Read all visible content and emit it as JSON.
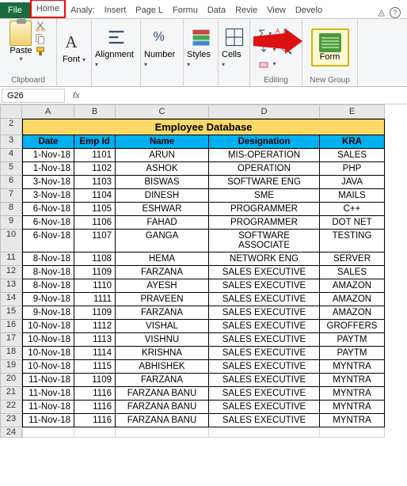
{
  "tabs": {
    "file": "File",
    "home": "Home",
    "analysis": "Analy:",
    "insert": "Insert",
    "pagelayout": "Page L",
    "formulas": "Formu",
    "data": "Data",
    "review": "Revie",
    "view": "View",
    "developer": "Develo"
  },
  "ribbon": {
    "clipboard": {
      "label": "Clipboard",
      "paste": "Paste"
    },
    "font": {
      "label": "Font"
    },
    "alignment": {
      "label": "Alignment"
    },
    "number": {
      "label": "Number"
    },
    "styles": {
      "label": "Styles"
    },
    "cells": {
      "label": "Cells"
    },
    "editing": {
      "label": "Editing"
    },
    "newgroup": {
      "label": "New Group",
      "form": "Form"
    }
  },
  "namebox": "G26",
  "fx": "fx",
  "columns": [
    "A",
    "B",
    "C",
    "D",
    "E"
  ],
  "title": "Employee Database",
  "headers": {
    "date": "Date",
    "empid": "Emp Id",
    "name": "Name",
    "designation": "Designation",
    "kra": "KRA"
  },
  "rows": [
    {
      "n": 4,
      "date": "1-Nov-18",
      "id": "1101",
      "name": "ARUN",
      "desig": "MIS-OPERATION",
      "kra": "SALES"
    },
    {
      "n": 5,
      "date": "1-Nov-18",
      "id": "1102",
      "name": "ASHOK",
      "desig": "OPERATION",
      "kra": "PHP"
    },
    {
      "n": 6,
      "date": "3-Nov-18",
      "id": "1103",
      "name": "BISWAS",
      "desig": "SOFTWARE ENG",
      "kra": "JAVA"
    },
    {
      "n": 7,
      "date": "3-Nov-18",
      "id": "1104",
      "name": "DINESH",
      "desig": "SME",
      "kra": "MAILS"
    },
    {
      "n": 8,
      "date": "6-Nov-18",
      "id": "1105",
      "name": "ESHWAR",
      "desig": "PROGRAMMER",
      "kra": "C++"
    },
    {
      "n": 9,
      "date": "6-Nov-18",
      "id": "1106",
      "name": "FAHAD",
      "desig": "PROGRAMMER",
      "kra": "DOT NET"
    },
    {
      "n": 10,
      "date": "6-Nov-18",
      "id": "1107",
      "name": "GANGA",
      "desig": "SOFTWARE ASSOCIATE",
      "kra": "TESTING"
    },
    {
      "n": 11,
      "date": "8-Nov-18",
      "id": "1108",
      "name": "HEMA",
      "desig": "NETWORK ENG",
      "kra": "SERVER"
    },
    {
      "n": 12,
      "date": "8-Nov-18",
      "id": "1109",
      "name": "FARZANA",
      "desig": "SALES EXECUTIVE",
      "kra": "SALES"
    },
    {
      "n": 13,
      "date": "8-Nov-18",
      "id": "1110",
      "name": "AYESH",
      "desig": "SALES EXECUTIVE",
      "kra": "AMAZON"
    },
    {
      "n": 14,
      "date": "9-Nov-18",
      "id": "1111",
      "name": "PRAVEEN",
      "desig": "SALES EXECUTIVE",
      "kra": "AMAZON"
    },
    {
      "n": 15,
      "date": "9-Nov-18",
      "id": "1109",
      "name": "FARZANA",
      "desig": "SALES EXECUTIVE",
      "kra": "AMAZON"
    },
    {
      "n": 16,
      "date": "10-Nov-18",
      "id": "1112",
      "name": "VISHAL",
      "desig": "SALES EXECUTIVE",
      "kra": "GROFFERS"
    },
    {
      "n": 17,
      "date": "10-Nov-18",
      "id": "1113",
      "name": "VISHNU",
      "desig": "SALES EXECUTIVE",
      "kra": "PAYTM"
    },
    {
      "n": 18,
      "date": "10-Nov-18",
      "id": "1114",
      "name": "KRISHNA",
      "desig": "SALES EXECUTIVE",
      "kra": "PAYTM"
    },
    {
      "n": 19,
      "date": "10-Nov-18",
      "id": "1115",
      "name": "ABHISHEK",
      "desig": "SALES EXECUTIVE",
      "kra": "MYNTRA"
    },
    {
      "n": 20,
      "date": "11-Nov-18",
      "id": "1109",
      "name": "FARZANA",
      "desig": "SALES EXECUTIVE",
      "kra": "MYNTRA"
    },
    {
      "n": 21,
      "date": "11-Nov-18",
      "id": "1116",
      "name": "FARZANA BANU",
      "desig": "SALES EXECUTIVE",
      "kra": "MYNTRA"
    },
    {
      "n": 22,
      "date": "11-Nov-18",
      "id": "1116",
      "name": "FARZANA BANU",
      "desig": "SALES EXECUTIVE",
      "kra": "MYNTRA"
    },
    {
      "n": 23,
      "date": "11-Nov-18",
      "id": "1116",
      "name": "FARZANA BANU",
      "desig": "SALES EXECUTIVE",
      "kra": "MYNTRA"
    }
  ]
}
